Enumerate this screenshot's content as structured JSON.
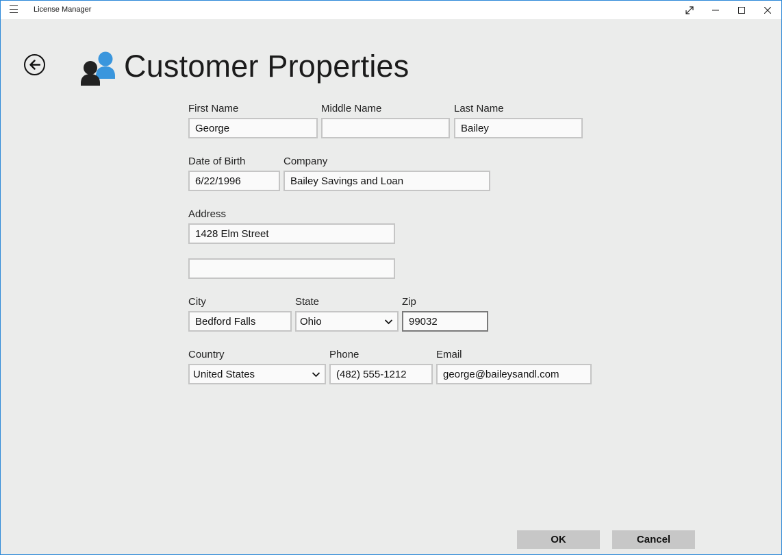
{
  "window": {
    "title": "License Manager",
    "controls": {
      "fullscreen_icon": "expand-icon",
      "minimize_icon": "minimize-icon",
      "maximize_icon": "maximize-icon",
      "close_icon": "close-icon"
    }
  },
  "header": {
    "back_icon": "back-arrow-icon",
    "page_icon": "customers-icon",
    "title": "Customer Properties"
  },
  "form": {
    "first_name": {
      "label": "First Name",
      "value": "George"
    },
    "middle_name": {
      "label": "Middle Name",
      "value": ""
    },
    "last_name": {
      "label": "Last Name",
      "value": "Bailey"
    },
    "date_of_birth": {
      "label": "Date of Birth",
      "value": "6/22/1996"
    },
    "company": {
      "label": "Company",
      "value": "Bailey Savings and Loan"
    },
    "address": {
      "label": "Address",
      "line1": "1428 Elm Street",
      "line2": ""
    },
    "city": {
      "label": "City",
      "value": "Bedford Falls"
    },
    "state": {
      "label": "State",
      "value": "Ohio"
    },
    "zip": {
      "label": "Zip",
      "value": "99032"
    },
    "country": {
      "label": "Country",
      "value": "United States"
    },
    "phone": {
      "label": "Phone",
      "value": "(482) 555-1212"
    },
    "email": {
      "label": "Email",
      "value": "george@baileysandl.com"
    }
  },
  "actions": {
    "ok_label": "OK",
    "cancel_label": "Cancel"
  },
  "colors": {
    "accent": "#2b88d8",
    "icon_primary": "#3a96dd",
    "icon_secondary": "#222222",
    "background": "#ebeceb"
  }
}
